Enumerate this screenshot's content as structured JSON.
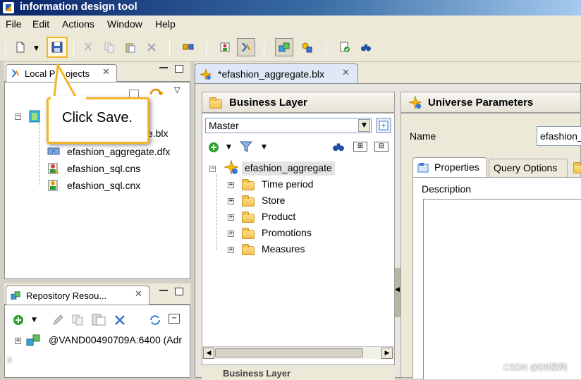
{
  "app": {
    "title": "information design tool"
  },
  "menu": [
    "File",
    "Edit",
    "Actions",
    "Window",
    "Help"
  ],
  "toolbar": {
    "icons": [
      "new-icon",
      "dropdown-arrow-icon",
      "save-icon",
      "cut-icon",
      "copy-icon",
      "paste-icon",
      "delete-icon",
      "resource-icon",
      "connection-icon",
      "universe-icon",
      "project-icon",
      "repository-icon",
      "check-integrity-icon",
      "find-icon"
    ]
  },
  "local_projects": {
    "tab_label": "Local Projects",
    "tab_label_visible_start": "Local P",
    "tab_label_visible_end": "ojects",
    "files": [
      {
        "label": "efashion_aggregate.blx",
        "visible": "te.blx",
        "icon": "business-layer-icon"
      },
      {
        "label": "efashion_aggregate.dfx",
        "visible": "efashion_aggregate.dfx",
        "icon": "data-foundation-icon"
      },
      {
        "label": "efashion_sql.cns",
        "visible": "efashion_sql.cns",
        "icon": "connection-shortcut-icon"
      },
      {
        "label": "efashion_sql.cnx",
        "visible": "efashion_sql.cnx",
        "icon": "connection-icon"
      }
    ]
  },
  "callout": {
    "prefix": "Click ",
    "action": "Save",
    "suffix": "."
  },
  "repository": {
    "tab_label": "Repository Resou...",
    "session": "@VAND00490709A:6400 (Adr"
  },
  "editor": {
    "tab_label": "*efashion_aggregate.blx",
    "business_layer": {
      "header": "Business Layer",
      "view": "Master",
      "root": "efashion_aggregate",
      "folders": [
        "Time period",
        "Store",
        "Product",
        "Promotions",
        "Measures"
      ],
      "bottom_tab": "Business Layer"
    },
    "universe_parameters": {
      "header": "Universe Parameters",
      "name_label": "Name",
      "name_value": "efashion_",
      "tabs": [
        "Properties",
        "Query Options"
      ],
      "description_label": "Description"
    }
  },
  "watermark": "CSDN @DB架构"
}
